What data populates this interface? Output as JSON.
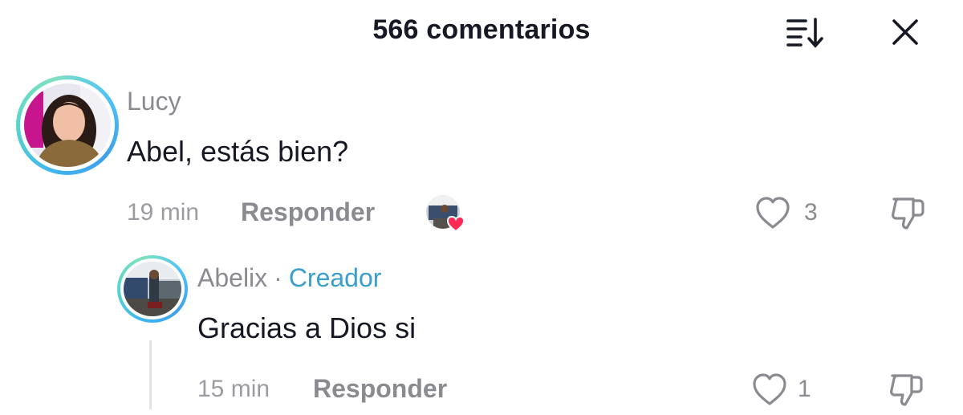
{
  "header": {
    "title": "566 comentarios",
    "sort_icon": "sort-list-icon",
    "close_icon": "close-icon"
  },
  "comments": [
    {
      "author": "Lucy",
      "text": "Abel, estás bien?",
      "time": "19 min",
      "reply_label": "Responder",
      "likes": "3",
      "liked_by_creator": true
    }
  ],
  "replies": [
    {
      "author": "Abelix",
      "separator": "·",
      "badge": "Creador",
      "text": "Gracias a Dios si",
      "time": "15 min",
      "reply_label": "Responder",
      "likes": "1"
    }
  ],
  "colors": {
    "text_primary": "#161823",
    "text_secondary": "#8a8b91",
    "creator_badge": "#3a9fcf",
    "heart": "#fe2c55",
    "ring_gradient": [
      "#3fb6f0",
      "#7fe0c0"
    ]
  }
}
